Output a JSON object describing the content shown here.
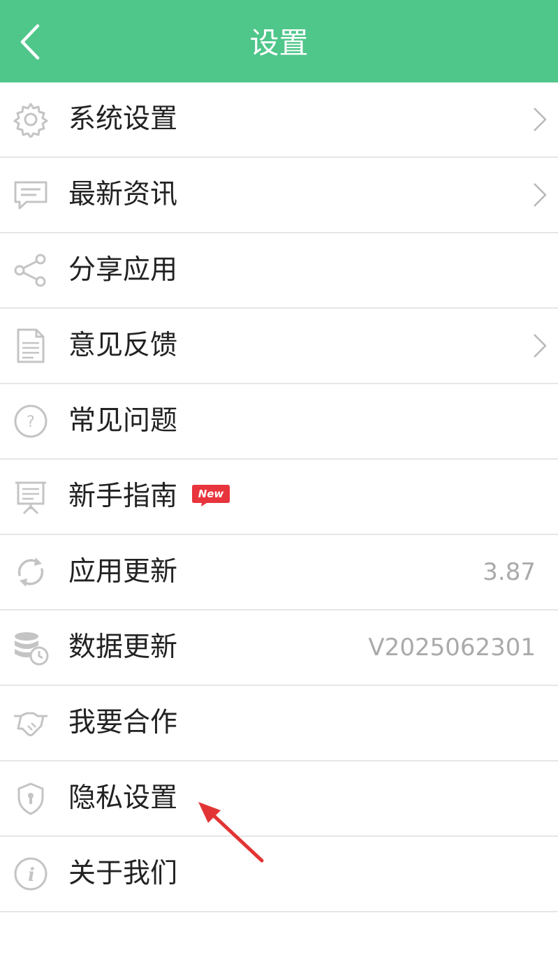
{
  "header": {
    "title": "设置",
    "back_icon": "chevron-left-icon"
  },
  "colors": {
    "header_bg": "#4fc68a",
    "icon_gray": "#c4c4c4",
    "badge_red": "#e8343c",
    "arrow_red": "#e23434"
  },
  "menu": {
    "items": [
      {
        "id": "system-settings",
        "label": "系统设置",
        "icon": "gear-icon",
        "chevron": true,
        "value": ""
      },
      {
        "id": "latest-news",
        "label": "最新资讯",
        "icon": "message-icon",
        "chevron": true,
        "value": ""
      },
      {
        "id": "share-app",
        "label": "分享应用",
        "icon": "share-icon",
        "chevron": false,
        "value": ""
      },
      {
        "id": "feedback",
        "label": "意见反馈",
        "icon": "document-icon",
        "chevron": true,
        "value": ""
      },
      {
        "id": "faq",
        "label": "常见问题",
        "icon": "question-icon",
        "chevron": false,
        "value": ""
      },
      {
        "id": "beginner-guide",
        "label": "新手指南",
        "icon": "presentation-icon",
        "chevron": false,
        "value": "",
        "badge": "New"
      },
      {
        "id": "app-update",
        "label": "应用更新",
        "icon": "refresh-icon",
        "chevron": false,
        "value": "3.87"
      },
      {
        "id": "data-update",
        "label": "数据更新",
        "icon": "database-refresh-icon",
        "chevron": false,
        "value": "V2025062301"
      },
      {
        "id": "cooperation",
        "label": "我要合作",
        "icon": "handshake-icon",
        "chevron": false,
        "value": ""
      },
      {
        "id": "privacy-settings",
        "label": "隐私设置",
        "icon": "shield-icon",
        "chevron": false,
        "value": ""
      },
      {
        "id": "about-us",
        "label": "关于我们",
        "icon": "info-icon",
        "chevron": false,
        "value": ""
      }
    ]
  }
}
